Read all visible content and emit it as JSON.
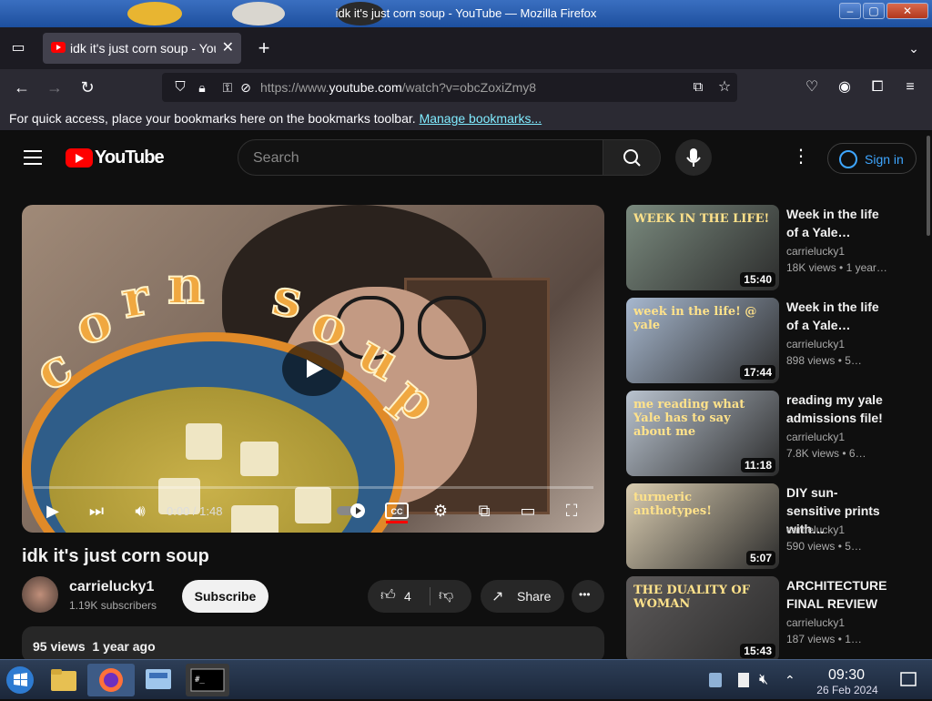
{
  "window": {
    "title": "idk it's just corn soup - YouTube — Mozilla Firefox",
    "controls": [
      "–",
      "▢",
      "✕"
    ]
  },
  "tabs": [
    {
      "label": "idk it's just corn soup - YouTube",
      "close": "✕"
    }
  ],
  "new_tab_label": "+",
  "navbar": {
    "url_prefix": "https://www.",
    "url_domain": "youtube.com",
    "url_suffix": "/watch?v=obcZoxiZmy8"
  },
  "bookmarks": {
    "message": "For quick access, place your bookmarks here on the bookmarks toolbar.",
    "link": "Manage bookmarks..."
  },
  "youtube": {
    "logo_text": "YouTube",
    "search_placeholder": "Search",
    "sign_in": "Sign in",
    "overlay_text": [
      "c",
      "o",
      "r",
      "n",
      "s",
      "o",
      "u",
      "p"
    ]
  },
  "player": {
    "time": "0:00 / 1:48",
    "progress": 0.0
  },
  "video": {
    "title": "idk it's just corn soup",
    "channel": "carrielucky1",
    "subscribers": "1.19K subscribers",
    "subscribe_label": "Subscribe",
    "likes": "4",
    "share_label": "Share",
    "more_label": "•••",
    "views": "95 views",
    "age": "1 year ago"
  },
  "recommendations": [
    {
      "title": "Week in the life of a Yale…",
      "channel": "carrielucky1",
      "views": "18K views",
      "age": "1 year…",
      "duration": "15:40",
      "thumb_text": "WEEK IN THE LIFE!",
      "bg": "#7a8a7e"
    },
    {
      "title": "Week in the life of a Yale…",
      "channel": "carrielucky1",
      "views": "898 views",
      "age": "5…",
      "duration": "17:44",
      "thumb_text": "week in the life! @ yale",
      "bg": "#a7b8cf"
    },
    {
      "title": "reading my yale admissions file!",
      "channel": "carrielucky1",
      "views": "7.8K views",
      "age": "6…",
      "duration": "11:18",
      "thumb_text": "me reading what Yale has to say about me",
      "bg": "#b9c3cf"
    },
    {
      "title": "DIY sun-sensitive prints with…",
      "channel": "carrielucky1",
      "views": "590 views",
      "age": "5…",
      "duration": "5:07",
      "thumb_text": "turmeric anthotypes!",
      "bg": "#d9ccb0"
    },
    {
      "title": "ARCHITECTURE FINAL REVIEW",
      "channel": "carrielucky1",
      "views": "187 views",
      "age": "1…",
      "duration": "15:43",
      "thumb_text": "THE DUALITY OF WOMAN",
      "bg": "#5d5a5a"
    }
  ],
  "taskbar": {
    "time": "09:30",
    "date": "26 Feb 2024"
  },
  "colors": {
    "youtube_red": "#ff0000",
    "link_blue": "#3ea6ff",
    "bookmark_link": "#80ebff"
  }
}
